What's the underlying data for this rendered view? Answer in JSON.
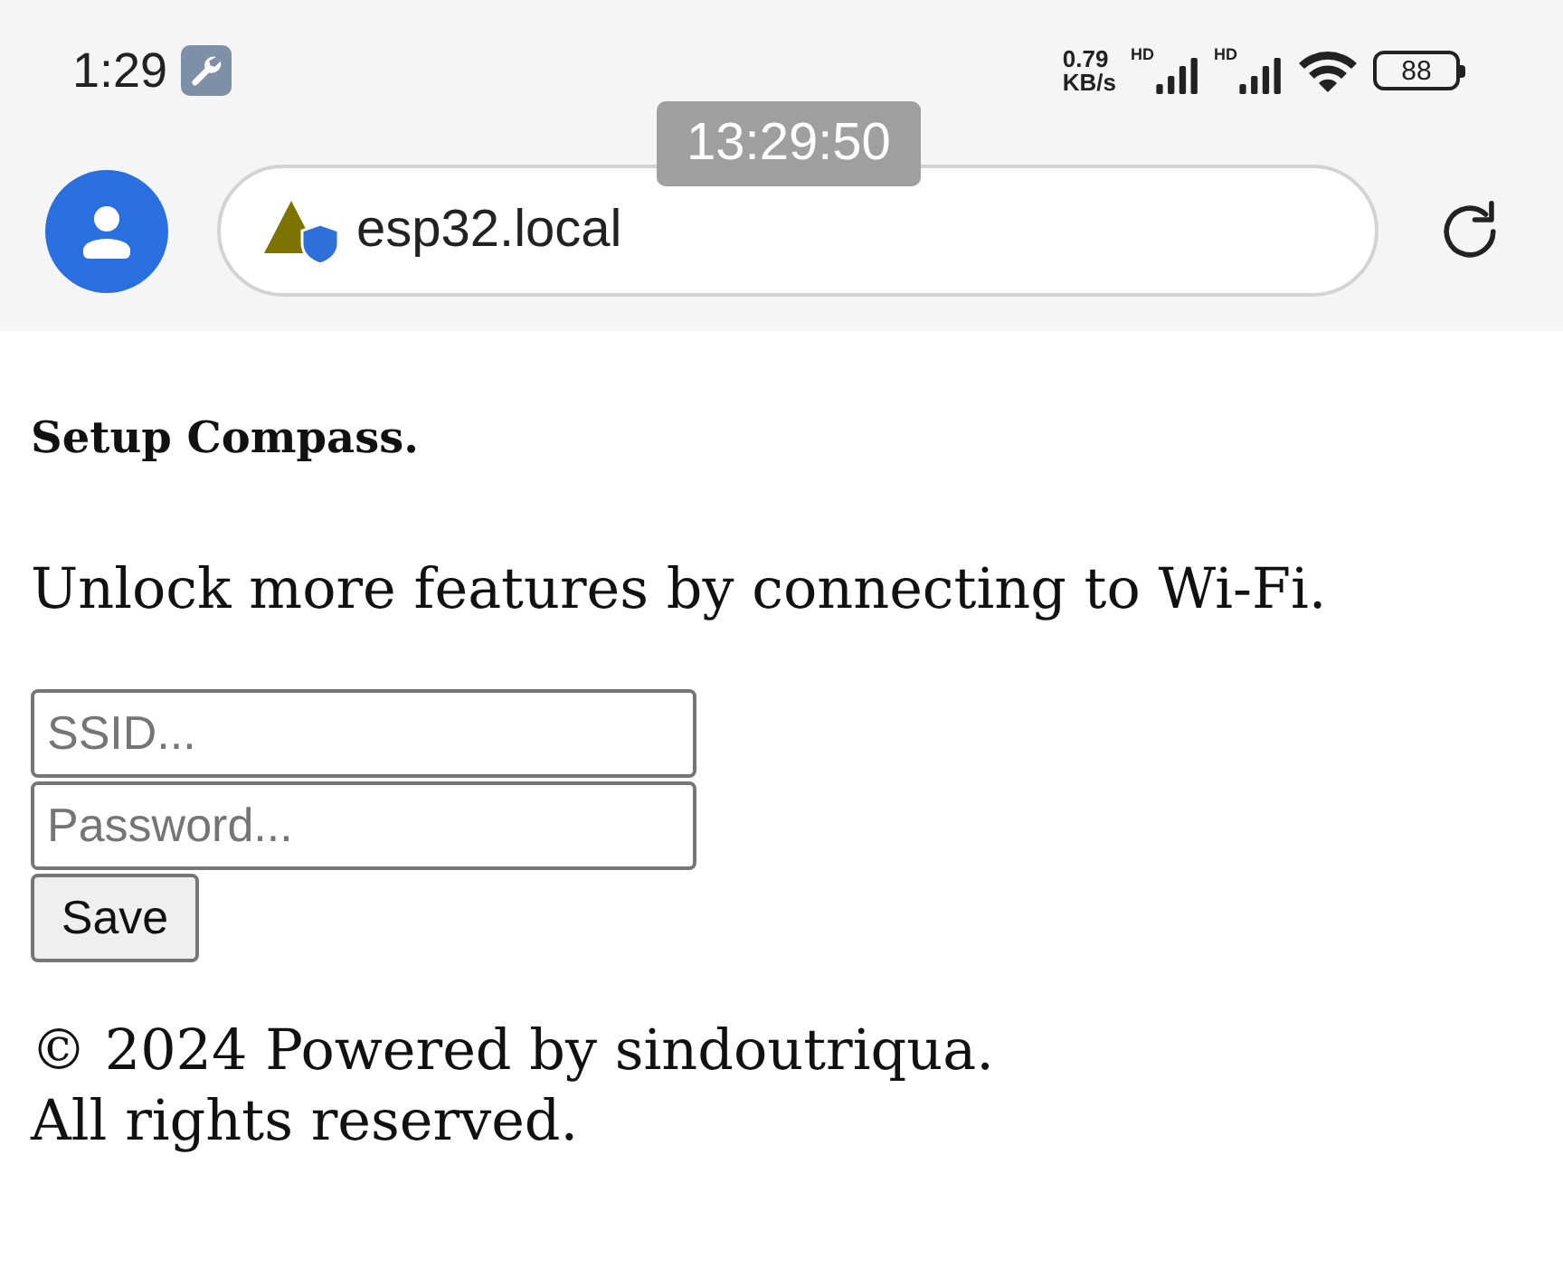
{
  "status_bar": {
    "time": "1:29",
    "network_speed": {
      "value": "0.79",
      "unit": "KB/s"
    },
    "signal_labels": [
      "HD",
      "HD"
    ],
    "battery": "88"
  },
  "overlay": {
    "timestamp": "13:29:50"
  },
  "browser": {
    "url": "esp32.local"
  },
  "page": {
    "heading": "Setup Compass.",
    "intro": "Unlock more features by connecting to Wi-Fi.",
    "form": {
      "fields": [
        {
          "placeholder": "SSID..."
        },
        {
          "placeholder": "Password..."
        }
      ],
      "button": "Save"
    },
    "footer": [
      "© 2024 Powered by sindoutriqua.",
      "All rights reserved."
    ]
  }
}
